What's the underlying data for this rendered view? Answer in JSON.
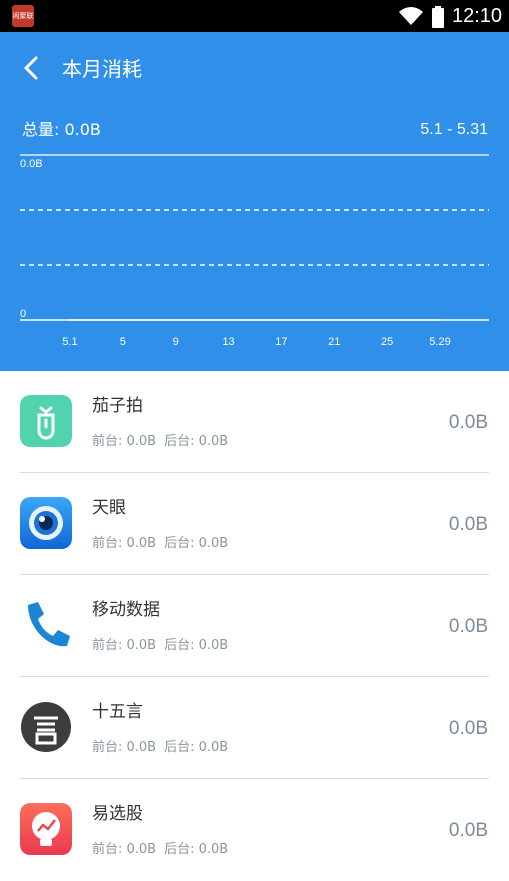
{
  "status_bar": {
    "app_icon_text": "闲聚联",
    "time": "12:10"
  },
  "header": {
    "title": "本月消耗",
    "total_label": "总量: 0.0B",
    "date_range": "5.1 - 5.31"
  },
  "chart_data": {
    "type": "line",
    "y_tick_labels": [
      "0.0B",
      "0"
    ],
    "x_tick_labels": [
      "5.1",
      "5",
      "9",
      "13",
      "17",
      "21",
      "25",
      "5.29"
    ],
    "x": [
      1,
      5,
      9,
      13,
      17,
      21,
      25,
      29
    ],
    "values": [
      0,
      0,
      0,
      0,
      0,
      0,
      0,
      0
    ],
    "ylim": [
      0,
      0
    ],
    "grid": "dashed horizontal"
  },
  "apps": [
    {
      "name": "茄子拍",
      "foreground": "前台: 0.0B",
      "background": "后台: 0.0B",
      "usage": "0.0B",
      "icon": "eggplant-icon"
    },
    {
      "name": "天眼",
      "foreground": "前台: 0.0B",
      "background": "后台: 0.0B",
      "usage": "0.0B",
      "icon": "eye-icon"
    },
    {
      "name": "移动数据",
      "foreground": "前台: 0.0B",
      "background": "后台: 0.0B",
      "usage": "0.0B",
      "icon": "phone-icon"
    },
    {
      "name": "十五言",
      "foreground": "前台: 0.0B",
      "background": "后台: 0.0B",
      "usage": "0.0B",
      "icon": "speech-icon"
    },
    {
      "name": "易选股",
      "foreground": "前台: 0.0B",
      "background": "后台: 0.0B",
      "usage": "0.0B",
      "icon": "stock-chart-icon"
    }
  ],
  "colors": {
    "header": "#2f8fe9",
    "divider": "#d7dde3",
    "usage_text": "#7d8b99"
  }
}
